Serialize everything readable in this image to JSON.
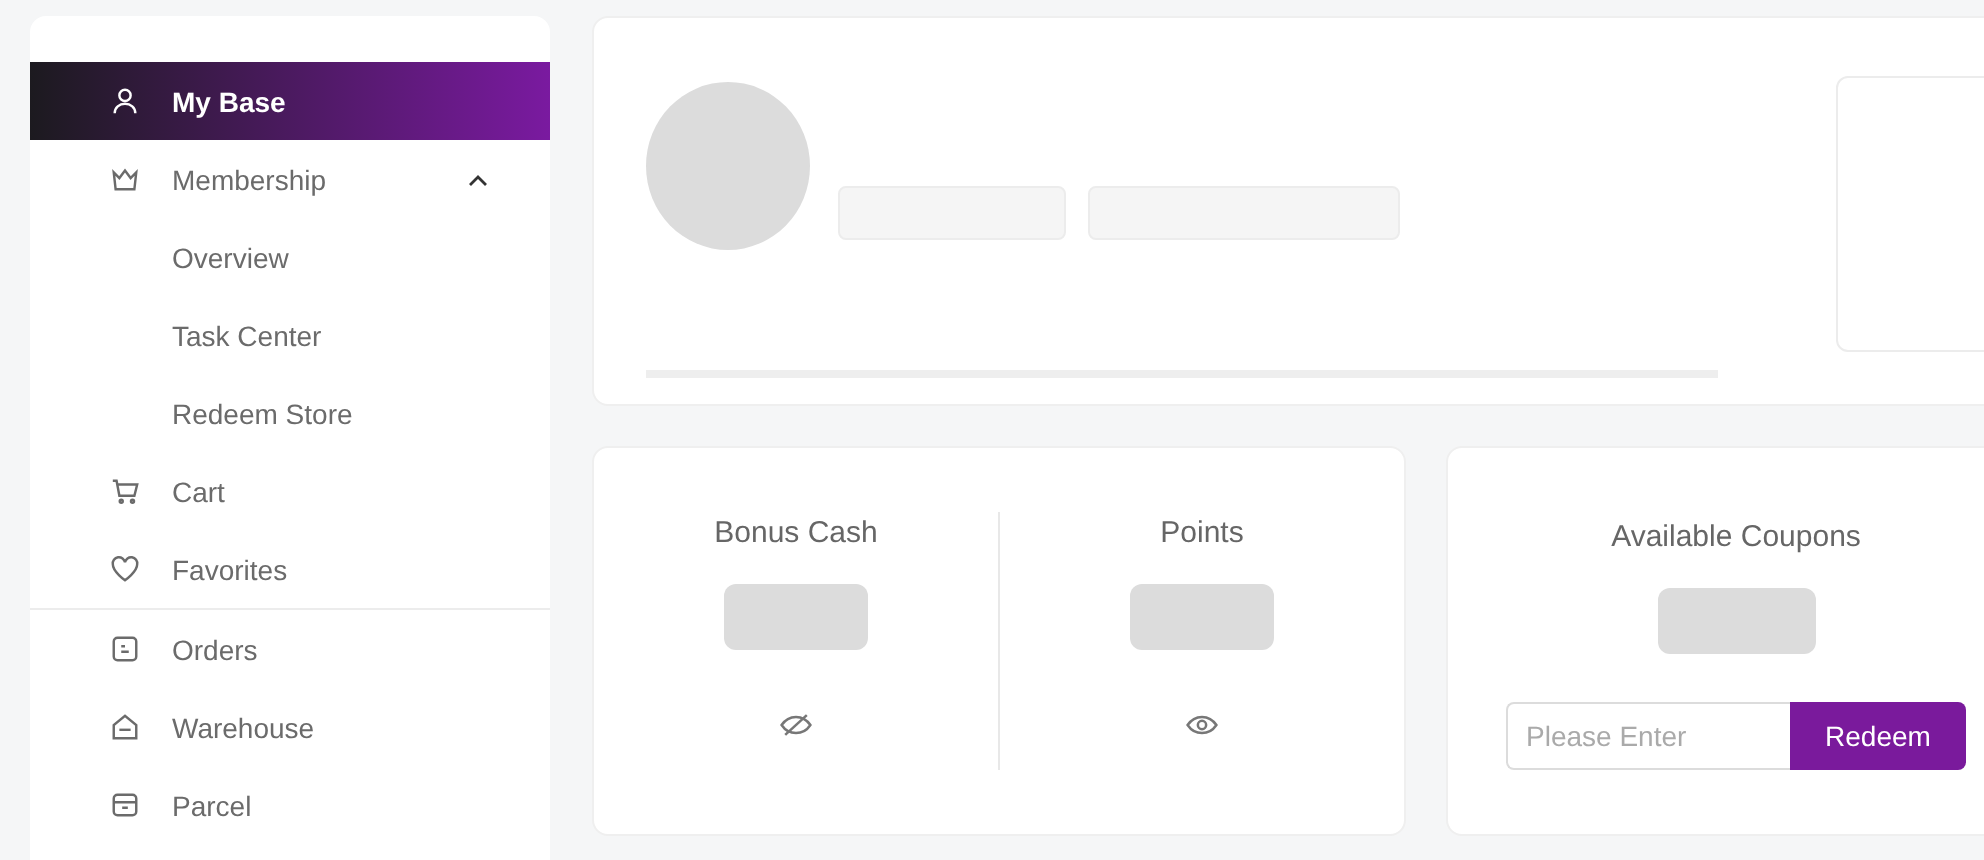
{
  "sidebar": {
    "groups": [
      {
        "items": [
          {
            "label": "My Base",
            "selected": true
          },
          {
            "label": "Membership",
            "selected": false,
            "expanded": true,
            "children": [
              {
                "label": "Overview",
                "selected": false
              },
              {
                "label": "Task Center",
                "selected": false
              },
              {
                "label": "Redeem Store",
                "selected": false
              }
            ]
          },
          {
            "label": "Cart",
            "selected": false
          },
          {
            "label": "Favorites",
            "selected": false
          }
        ]
      },
      {
        "items": [
          {
            "label": "Orders",
            "selected": false
          },
          {
            "label": "Warehouse",
            "selected": false
          },
          {
            "label": "Parcel",
            "selected": false
          }
        ]
      }
    ]
  },
  "balances": [
    {
      "label": "Bonus Cash",
      "hidden": true
    },
    {
      "label": "Points",
      "hidden": false
    }
  ],
  "coupons": {
    "title": "Available Coupons",
    "input": {
      "placeholder": "Please Enter"
    },
    "button": "Redeem"
  }
}
